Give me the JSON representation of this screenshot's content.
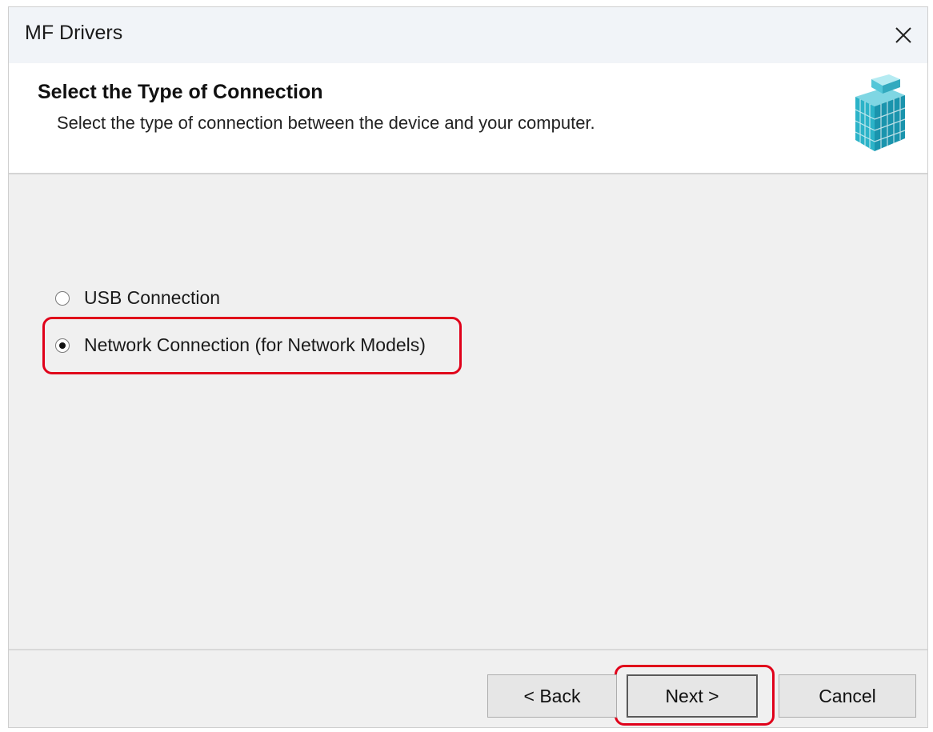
{
  "window": {
    "title": "MF Drivers"
  },
  "header": {
    "title": "Select the Type of Connection",
    "subtitle": "Select the type of connection between the device and your computer.",
    "graphic_icon": "printer-cube-icon",
    "graphic_color": "#2bb3c8"
  },
  "options": {
    "usb": {
      "label": "USB Connection",
      "selected": false
    },
    "network": {
      "label": "Network Connection (for Network Models)",
      "selected": true
    }
  },
  "buttons": {
    "back_label": "< Back",
    "next_label": "Next >",
    "cancel_label": "Cancel"
  },
  "highlight_color": "#e0001a"
}
